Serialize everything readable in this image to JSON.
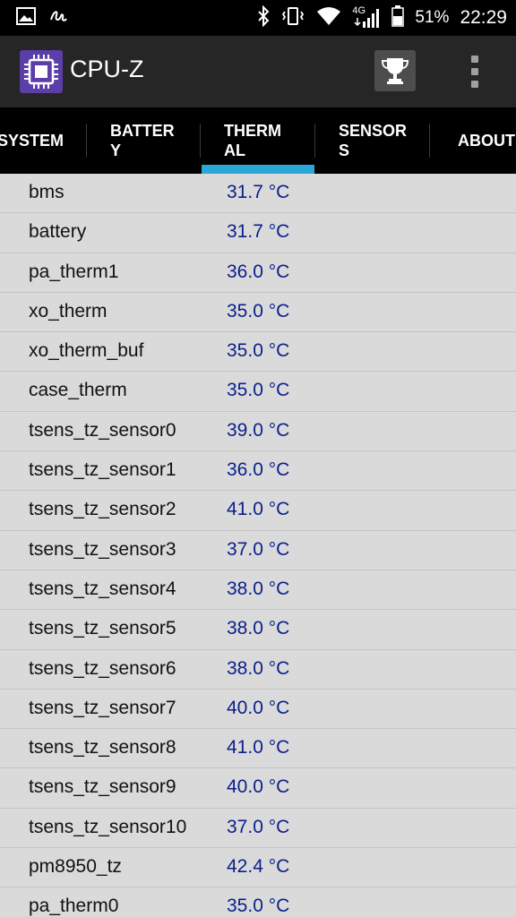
{
  "status_bar": {
    "network_type": "4G",
    "battery_percent": "51%",
    "time": "22:29",
    "icons": [
      "image-icon",
      "signature-icon",
      "bluetooth-icon",
      "vibrate-icon",
      "wifi-icon",
      "signal-icon",
      "battery-icon"
    ]
  },
  "app_bar": {
    "title": "CPU-Z",
    "icons": [
      "cpu-chip-icon",
      "trophy-icon",
      "overflow-menu-icon"
    ]
  },
  "tabs": [
    {
      "line1": "SYSTEM",
      "line2": "",
      "active": false
    },
    {
      "line1": "BATTER",
      "line2": "Y",
      "active": false
    },
    {
      "line1": "THERM",
      "line2": "AL",
      "active": true
    },
    {
      "line1": "SENSOR",
      "line2": "S",
      "active": false
    },
    {
      "line1": "ABOUT",
      "line2": "",
      "active": false
    }
  ],
  "accent_color": "#2aa6d8",
  "value_color": "#0a1f8a",
  "sensors": [
    {
      "name": "bms",
      "value": "31.7 °C"
    },
    {
      "name": "battery",
      "value": "31.7 °C"
    },
    {
      "name": "pa_therm1",
      "value": "36.0 °C"
    },
    {
      "name": "xo_therm",
      "value": "35.0 °C"
    },
    {
      "name": "xo_therm_buf",
      "value": "35.0 °C"
    },
    {
      "name": "case_therm",
      "value": "35.0 °C"
    },
    {
      "name": "tsens_tz_sensor0",
      "value": "39.0 °C"
    },
    {
      "name": "tsens_tz_sensor1",
      "value": "36.0 °C"
    },
    {
      "name": "tsens_tz_sensor2",
      "value": "41.0 °C"
    },
    {
      "name": "tsens_tz_sensor3",
      "value": "37.0 °C"
    },
    {
      "name": "tsens_tz_sensor4",
      "value": "38.0 °C"
    },
    {
      "name": "tsens_tz_sensor5",
      "value": "38.0 °C"
    },
    {
      "name": "tsens_tz_sensor6",
      "value": "38.0 °C"
    },
    {
      "name": "tsens_tz_sensor7",
      "value": "40.0 °C"
    },
    {
      "name": "tsens_tz_sensor8",
      "value": "41.0 °C"
    },
    {
      "name": "tsens_tz_sensor9",
      "value": "40.0 °C"
    },
    {
      "name": "tsens_tz_sensor10",
      "value": "37.0 °C"
    },
    {
      "name": "pm8950_tz",
      "value": "42.4 °C"
    },
    {
      "name": "pa_therm0",
      "value": "35.0 °C"
    }
  ]
}
